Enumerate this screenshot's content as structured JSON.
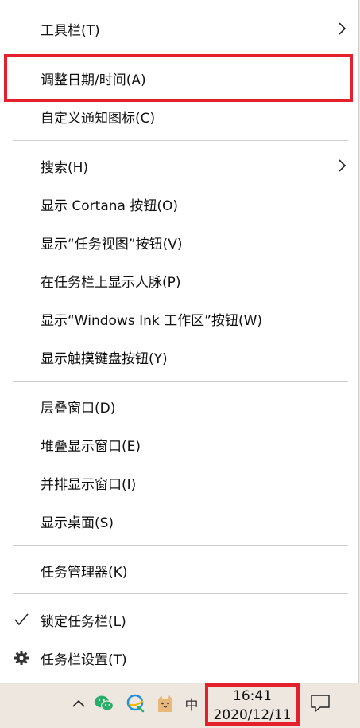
{
  "menu": {
    "items": [
      {
        "label": "工具栏(T)",
        "submenu": true
      },
      {
        "label": "调整日期/时间(A)",
        "submenu": false
      },
      {
        "label": "自定义通知图标(C)",
        "submenu": false
      },
      {
        "label": "搜索(H)",
        "submenu": true
      },
      {
        "label": "显示 Cortana 按钮(O)",
        "submenu": false
      },
      {
        "label": "显示“任务视图”按钮(V)",
        "submenu": false
      },
      {
        "label": "在任务栏上显示人脉(P)",
        "submenu": false
      },
      {
        "label": "显示“Windows Ink 工作区”按钮(W)",
        "submenu": false
      },
      {
        "label": "显示触摸键盘按钮(Y)",
        "submenu": false
      },
      {
        "label": "层叠窗口(D)",
        "submenu": false
      },
      {
        "label": "堆叠显示窗口(E)",
        "submenu": false
      },
      {
        "label": "并排显示窗口(I)",
        "submenu": false
      },
      {
        "label": "显示桌面(S)",
        "submenu": false
      },
      {
        "label": "任务管理器(K)",
        "submenu": false
      },
      {
        "label": "锁定任务栏(L)",
        "checked": true
      },
      {
        "label": "任务栏设置(T)",
        "icon": "gear-icon"
      }
    ]
  },
  "taskbar": {
    "ime_label": "中",
    "time": "16:41",
    "date": "2020/12/11",
    "icons": [
      "chevron-up-icon",
      "wechat-icon",
      "qq-browser-icon",
      "cat-app-icon",
      "ime-icon",
      "notification-icon"
    ]
  },
  "colors": {
    "highlight": "#e5202d",
    "menu_bg": "#ffffff",
    "taskbar_bg": "#eee7e0",
    "wechat": "#2aae67"
  }
}
